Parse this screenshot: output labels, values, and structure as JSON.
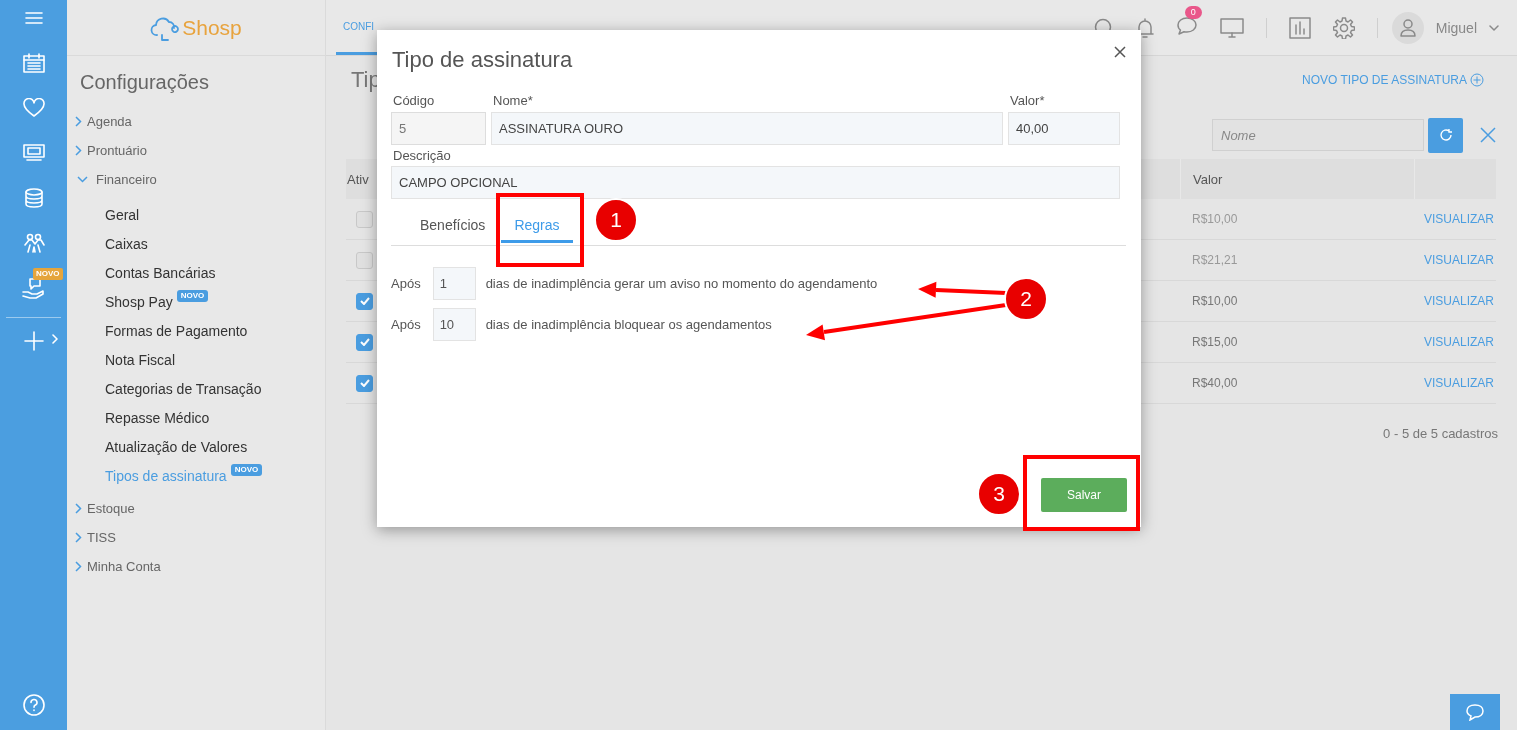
{
  "rail": {
    "badge": "NOVO"
  },
  "sidebar": {
    "logo": "Shosp",
    "title": "Configurações",
    "items": [
      {
        "label": "Agenda",
        "expanded": false
      },
      {
        "label": "Prontuário",
        "expanded": false
      },
      {
        "label": "Financeiro",
        "expanded": true,
        "children": [
          {
            "label": "Geral",
            "selected": false
          },
          {
            "label": "Caixas",
            "selected": false
          },
          {
            "label": "Contas Bancárias",
            "selected": false
          },
          {
            "label": "Shosp Pay",
            "selected": false,
            "badge": "NOVO"
          },
          {
            "label": "Formas de Pagamento",
            "selected": false
          },
          {
            "label": "Nota Fiscal",
            "selected": false
          },
          {
            "label": "Categorias de Transação",
            "selected": false
          },
          {
            "label": "Repasse Médico",
            "selected": false
          },
          {
            "label": "Atualização de Valores",
            "selected": false
          },
          {
            "label": "Tipos de assinatura",
            "selected": true,
            "badge": "NOVO"
          }
        ]
      },
      {
        "label": "Estoque",
        "expanded": false
      },
      {
        "label": "TISS",
        "expanded": false
      },
      {
        "label": "Minha Conta",
        "expanded": false
      }
    ]
  },
  "header": {
    "tab": "CONFI",
    "notifications": "0",
    "user": "Miguel"
  },
  "page": {
    "title": "Tip",
    "new_link": "NOVO TIPO DE ASSINATURA",
    "search": {
      "placeholder": "Nome"
    },
    "table": {
      "columns": [
        "Ativ",
        "Valor"
      ],
      "rows": [
        {
          "checked": false,
          "value": "R$10,00",
          "action": "VISUALIZAR"
        },
        {
          "checked": false,
          "value": "R$21,21",
          "action": "VISUALIZAR"
        },
        {
          "checked": true,
          "value": "R$10,00",
          "action": "VISUALIZAR"
        },
        {
          "checked": true,
          "value": "R$15,00",
          "action": "VISUALIZAR"
        },
        {
          "checked": true,
          "value": "R$40,00",
          "action": "VISUALIZAR"
        }
      ]
    },
    "pagination": "0 - 5 de 5 cadastros"
  },
  "modal": {
    "title": "Tipo de assinatura",
    "fields": [
      {
        "label": "Código",
        "value": "5",
        "disabled": true
      },
      {
        "label": "Nome*",
        "value": "ASSINATURA OURO",
        "disabled": false
      },
      {
        "label": "Valor*",
        "value": "40,00",
        "disabled": false
      },
      {
        "label": "Descrição",
        "value": "CAMPO OPCIONAL",
        "disabled": false
      }
    ],
    "tabs": [
      {
        "label": "Benefícios",
        "selected": false
      },
      {
        "label": "Regras",
        "selected": true
      }
    ],
    "rules": [
      {
        "prefix": "Após",
        "value": "1",
        "text": "dias de inadimplência gerar um aviso no momento do agendamento"
      },
      {
        "prefix": "Após",
        "value": "10",
        "text": "dias de inadimplência bloquear os agendamentos"
      }
    ],
    "save": "Salvar"
  },
  "annotations": [
    {
      "number": "1"
    },
    {
      "number": "2"
    },
    {
      "number": "3"
    }
  ]
}
